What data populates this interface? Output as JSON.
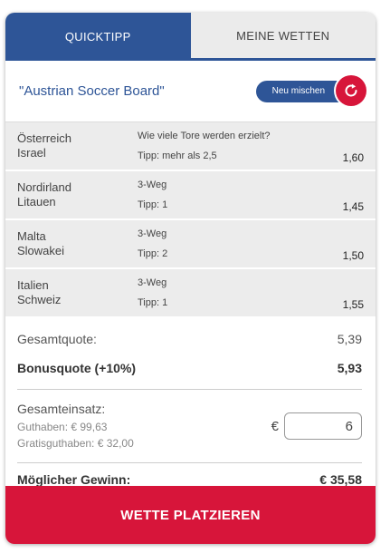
{
  "tabs": [
    {
      "label": "QUICKTIPP"
    },
    {
      "label": "MEINE WETTEN"
    }
  ],
  "board": {
    "name": "\"Austrian Soccer Board\"",
    "mix_label": "Neu mischen",
    "mix_icon": "refresh-icon"
  },
  "matches": [
    {
      "team1": "Österreich",
      "team2": "Israel",
      "market": "Wie viele Tore werden erzielt?",
      "tip": "Tipp: mehr als 2,5",
      "odd": "1,60"
    },
    {
      "team1": "Nordirland",
      "team2": "Litauen",
      "market": "3-Weg",
      "tip": "Tipp: 1",
      "odd": "1,45"
    },
    {
      "team1": "Malta",
      "team2": "Slowakei",
      "market": "3-Weg",
      "tip": "Tipp: 2",
      "odd": "1,50"
    },
    {
      "team1": "Italien",
      "team2": "Schweiz",
      "market": "3-Weg",
      "tip": "Tipp: 1",
      "odd": "1,55"
    }
  ],
  "summary": {
    "total_label": "Gesamtquote:",
    "total_value": "5,39",
    "bonus_label": "Bonusquote (+10%)",
    "bonus_value": "5,93",
    "stake_label": "Gesamteinsatz:",
    "balance": "Guthaben: € 99,63",
    "free_balance": "Gratisguthaben: € 32,00",
    "currency": "€",
    "stake_value": "6",
    "win_label": "Möglicher Gewinn:",
    "win_value": "€ 35,58"
  },
  "place_button": "WETTE PLATZIEREN",
  "colors": {
    "primary_blue": "#2e5597",
    "accent_red": "#d7153a"
  }
}
